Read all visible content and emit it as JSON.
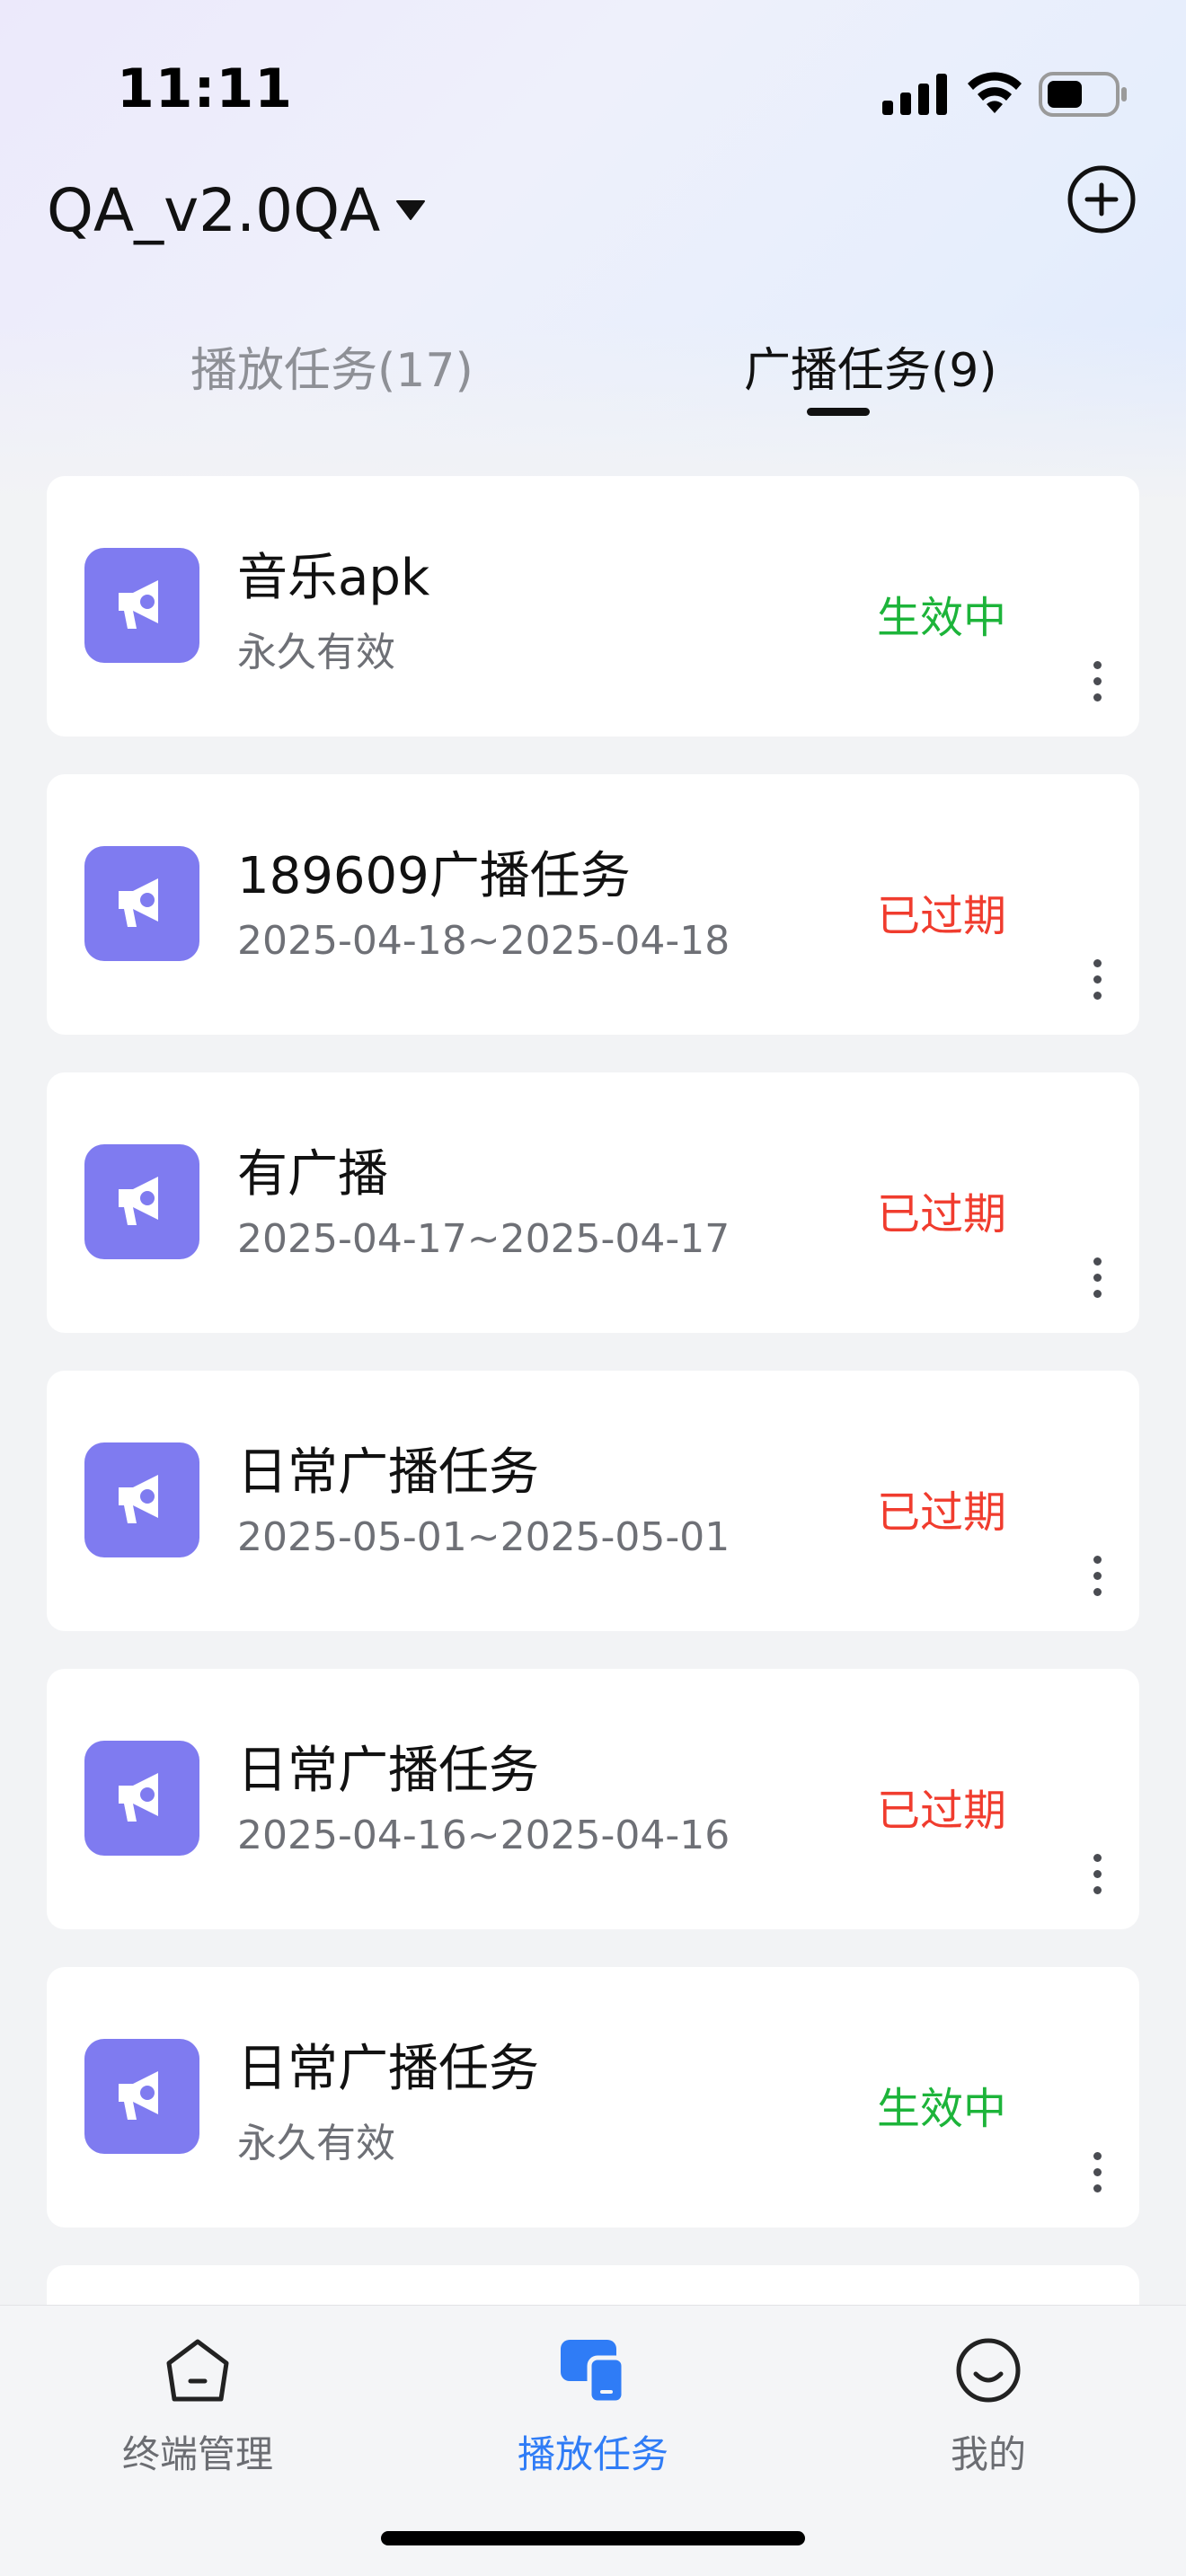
{
  "status_bar": {
    "time": "11:11"
  },
  "header": {
    "title": "QA_v2.0QA"
  },
  "tabs": [
    {
      "label": "播放任务(17)",
      "active": false
    },
    {
      "label": "广播任务(9)",
      "active": true
    }
  ],
  "tasks": [
    {
      "title": "音乐apk",
      "subtitle": "永久有效",
      "status": "生效中",
      "status_type": "active"
    },
    {
      "title": "189609广播任务",
      "subtitle": "2025-04-18~2025-04-18",
      "status": "已过期",
      "status_type": "expired"
    },
    {
      "title": "有广播",
      "subtitle": "2025-04-17~2025-04-17",
      "status": "已过期",
      "status_type": "expired"
    },
    {
      "title": "日常广播任务",
      "subtitle": "2025-05-01~2025-05-01",
      "status": "已过期",
      "status_type": "expired"
    },
    {
      "title": "日常广播任务",
      "subtitle": "2025-04-16~2025-04-16",
      "status": "已过期",
      "status_type": "expired"
    },
    {
      "title": "日常广播任务",
      "subtitle": "永久有效",
      "status": "生效中",
      "status_type": "active"
    }
  ],
  "bottom_nav": [
    {
      "label": "终端管理",
      "icon": "home-icon",
      "active": false
    },
    {
      "label": "播放任务",
      "icon": "devices-icon",
      "active": true
    },
    {
      "label": "我的",
      "icon": "smile-icon",
      "active": false
    }
  ],
  "colors": {
    "accent": "#2f7cf6",
    "active_status": "#1db43a",
    "expired_status": "#f03c2e",
    "task_icon_bg": "#7f7bf0"
  }
}
